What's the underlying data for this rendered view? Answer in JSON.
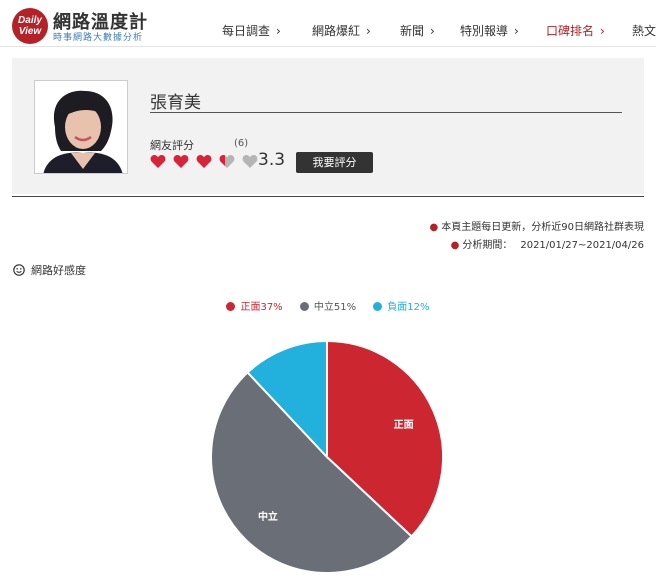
{
  "brand": {
    "logo_line1": "Daily",
    "logo_line2": "View",
    "title": "網路溫度計",
    "subtitle": "時事網路大數據分析"
  },
  "nav": {
    "items": [
      {
        "label": "每日調查",
        "active": false
      },
      {
        "label": "網路爆紅",
        "active": false
      },
      {
        "label": "新聞",
        "active": false
      },
      {
        "label": "特別報導",
        "active": false
      },
      {
        "label": "口碑排名",
        "active": true
      },
      {
        "label": "熱文",
        "active": false
      }
    ]
  },
  "profile": {
    "name": "張育美",
    "rating_label": "網友評分",
    "rating_count": "(6)",
    "score": "3.3",
    "score_value": 3.3,
    "rate_button": "我要評分"
  },
  "notes": {
    "update": "本頁主題每日更新，分析近90日網路社群表現",
    "period_label": "分析期間：",
    "period": "2021/01/27~2021/04/26"
  },
  "section": {
    "title": "網路好感度",
    "icon": "smile-icon"
  },
  "colors": {
    "brand": "#b52128",
    "positive": "#cc2631",
    "neutral": "#6a6f77",
    "negative": "#22b0dc"
  },
  "chart_data": {
    "type": "pie",
    "legend": [
      "正面37%",
      "中立51%",
      "負面12%"
    ],
    "slices": [
      {
        "label": "正面",
        "value": 37,
        "inner_label": "正面"
      },
      {
        "label": "中立",
        "value": 51,
        "inner_label": "中立"
      },
      {
        "label": "負面",
        "value": 12,
        "inner_label": ""
      }
    ],
    "legend_position": "top"
  }
}
